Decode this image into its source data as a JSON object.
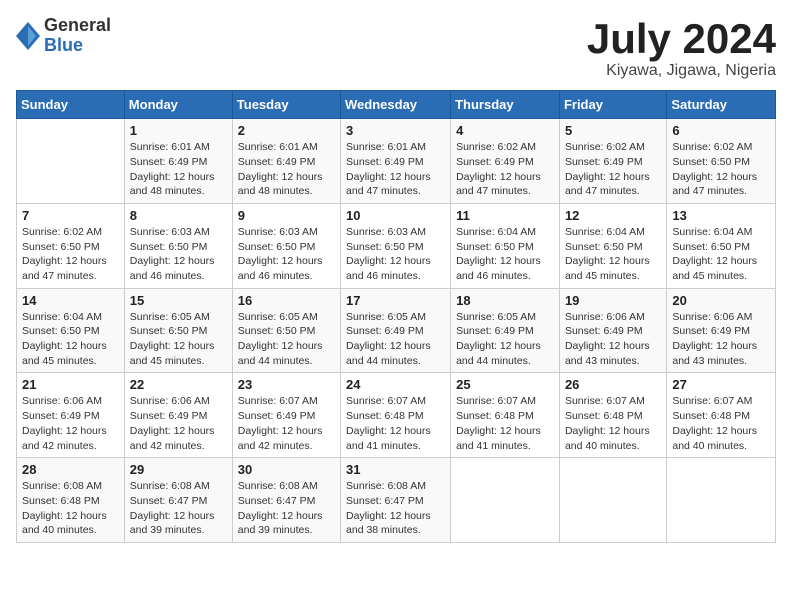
{
  "header": {
    "logo_general": "General",
    "logo_blue": "Blue",
    "title": "July 2024",
    "subtitle": "Kiyawa, Jigawa, Nigeria"
  },
  "calendar": {
    "days_of_week": [
      "Sunday",
      "Monday",
      "Tuesday",
      "Wednesday",
      "Thursday",
      "Friday",
      "Saturday"
    ],
    "weeks": [
      [
        {
          "day": "",
          "info": ""
        },
        {
          "day": "1",
          "info": "Sunrise: 6:01 AM\nSunset: 6:49 PM\nDaylight: 12 hours\nand 48 minutes."
        },
        {
          "day": "2",
          "info": "Sunrise: 6:01 AM\nSunset: 6:49 PM\nDaylight: 12 hours\nand 48 minutes."
        },
        {
          "day": "3",
          "info": "Sunrise: 6:01 AM\nSunset: 6:49 PM\nDaylight: 12 hours\nand 47 minutes."
        },
        {
          "day": "4",
          "info": "Sunrise: 6:02 AM\nSunset: 6:49 PM\nDaylight: 12 hours\nand 47 minutes."
        },
        {
          "day": "5",
          "info": "Sunrise: 6:02 AM\nSunset: 6:49 PM\nDaylight: 12 hours\nand 47 minutes."
        },
        {
          "day": "6",
          "info": "Sunrise: 6:02 AM\nSunset: 6:50 PM\nDaylight: 12 hours\nand 47 minutes."
        }
      ],
      [
        {
          "day": "7",
          "info": "Sunrise: 6:02 AM\nSunset: 6:50 PM\nDaylight: 12 hours\nand 47 minutes."
        },
        {
          "day": "8",
          "info": "Sunrise: 6:03 AM\nSunset: 6:50 PM\nDaylight: 12 hours\nand 46 minutes."
        },
        {
          "day": "9",
          "info": "Sunrise: 6:03 AM\nSunset: 6:50 PM\nDaylight: 12 hours\nand 46 minutes."
        },
        {
          "day": "10",
          "info": "Sunrise: 6:03 AM\nSunset: 6:50 PM\nDaylight: 12 hours\nand 46 minutes."
        },
        {
          "day": "11",
          "info": "Sunrise: 6:04 AM\nSunset: 6:50 PM\nDaylight: 12 hours\nand 46 minutes."
        },
        {
          "day": "12",
          "info": "Sunrise: 6:04 AM\nSunset: 6:50 PM\nDaylight: 12 hours\nand 45 minutes."
        },
        {
          "day": "13",
          "info": "Sunrise: 6:04 AM\nSunset: 6:50 PM\nDaylight: 12 hours\nand 45 minutes."
        }
      ],
      [
        {
          "day": "14",
          "info": "Sunrise: 6:04 AM\nSunset: 6:50 PM\nDaylight: 12 hours\nand 45 minutes."
        },
        {
          "day": "15",
          "info": "Sunrise: 6:05 AM\nSunset: 6:50 PM\nDaylight: 12 hours\nand 45 minutes."
        },
        {
          "day": "16",
          "info": "Sunrise: 6:05 AM\nSunset: 6:50 PM\nDaylight: 12 hours\nand 44 minutes."
        },
        {
          "day": "17",
          "info": "Sunrise: 6:05 AM\nSunset: 6:49 PM\nDaylight: 12 hours\nand 44 minutes."
        },
        {
          "day": "18",
          "info": "Sunrise: 6:05 AM\nSunset: 6:49 PM\nDaylight: 12 hours\nand 44 minutes."
        },
        {
          "day": "19",
          "info": "Sunrise: 6:06 AM\nSunset: 6:49 PM\nDaylight: 12 hours\nand 43 minutes."
        },
        {
          "day": "20",
          "info": "Sunrise: 6:06 AM\nSunset: 6:49 PM\nDaylight: 12 hours\nand 43 minutes."
        }
      ],
      [
        {
          "day": "21",
          "info": "Sunrise: 6:06 AM\nSunset: 6:49 PM\nDaylight: 12 hours\nand 42 minutes."
        },
        {
          "day": "22",
          "info": "Sunrise: 6:06 AM\nSunset: 6:49 PM\nDaylight: 12 hours\nand 42 minutes."
        },
        {
          "day": "23",
          "info": "Sunrise: 6:07 AM\nSunset: 6:49 PM\nDaylight: 12 hours\nand 42 minutes."
        },
        {
          "day": "24",
          "info": "Sunrise: 6:07 AM\nSunset: 6:48 PM\nDaylight: 12 hours\nand 41 minutes."
        },
        {
          "day": "25",
          "info": "Sunrise: 6:07 AM\nSunset: 6:48 PM\nDaylight: 12 hours\nand 41 minutes."
        },
        {
          "day": "26",
          "info": "Sunrise: 6:07 AM\nSunset: 6:48 PM\nDaylight: 12 hours\nand 40 minutes."
        },
        {
          "day": "27",
          "info": "Sunrise: 6:07 AM\nSunset: 6:48 PM\nDaylight: 12 hours\nand 40 minutes."
        }
      ],
      [
        {
          "day": "28",
          "info": "Sunrise: 6:08 AM\nSunset: 6:48 PM\nDaylight: 12 hours\nand 40 minutes."
        },
        {
          "day": "29",
          "info": "Sunrise: 6:08 AM\nSunset: 6:47 PM\nDaylight: 12 hours\nand 39 minutes."
        },
        {
          "day": "30",
          "info": "Sunrise: 6:08 AM\nSunset: 6:47 PM\nDaylight: 12 hours\nand 39 minutes."
        },
        {
          "day": "31",
          "info": "Sunrise: 6:08 AM\nSunset: 6:47 PM\nDaylight: 12 hours\nand 38 minutes."
        },
        {
          "day": "",
          "info": ""
        },
        {
          "day": "",
          "info": ""
        },
        {
          "day": "",
          "info": ""
        }
      ]
    ]
  }
}
